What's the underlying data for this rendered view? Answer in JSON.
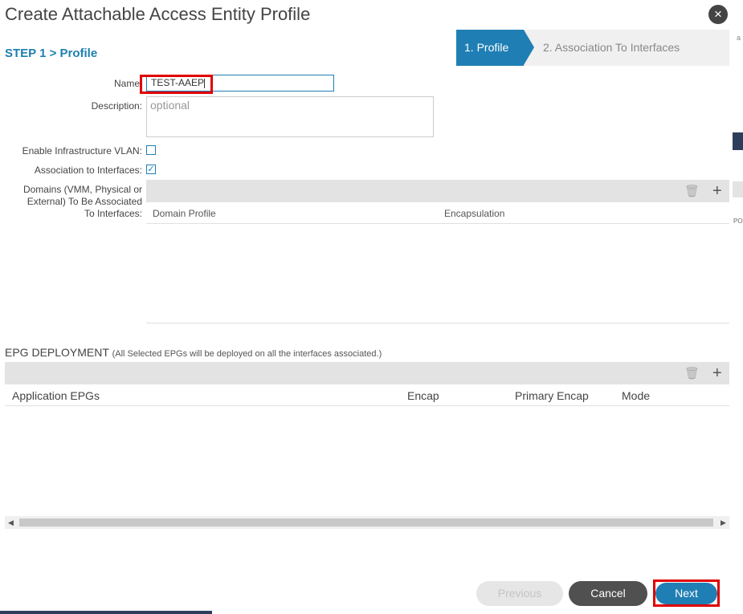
{
  "dialog": {
    "title": "Create Attachable Access Entity Profile",
    "close_icon": "×"
  },
  "step_label": "STEP 1 > Profile",
  "wizard": {
    "steps": [
      {
        "label": "1. Profile",
        "active": true
      },
      {
        "label": "2. Association To Interfaces",
        "active": false
      }
    ]
  },
  "form": {
    "name_label": "Name",
    "name_value": "TEST-AAEP",
    "description_label": "Description:",
    "description_placeholder": "optional",
    "infra_vlan_label": "Enable Infrastructure VLAN:",
    "infra_vlan_checked": false,
    "assoc_label": "Association to Interfaces:",
    "assoc_checked": true,
    "check_glyph": "✓",
    "domains_label_1": "Domains (VMM, Physical or",
    "domains_label_2": "External) To Be Associated",
    "domains_label_3": "To Interfaces:"
  },
  "domains_table": {
    "columns": [
      "Domain Profile",
      "Encapsulation"
    ],
    "rows": []
  },
  "epg": {
    "title": "EPG DEPLOYMENT",
    "subtitle": "(All Selected EPGs will be deployed on all the interfaces associated.)",
    "columns": [
      "Application EPGs",
      "Encap",
      "Primary Encap",
      "Mode"
    ],
    "rows": []
  },
  "toolbar_icons": {
    "delete": "🗑",
    "add": "+"
  },
  "scroll_arrows": {
    "left": "◀",
    "right": "▶"
  },
  "background_fragments": {
    "top_right": "a",
    "side": "PO"
  },
  "buttons": {
    "previous": "Previous",
    "cancel": "Cancel",
    "next": "Next"
  },
  "colors": {
    "accent": "#1f7fb4",
    "highlight": "#e00000"
  }
}
